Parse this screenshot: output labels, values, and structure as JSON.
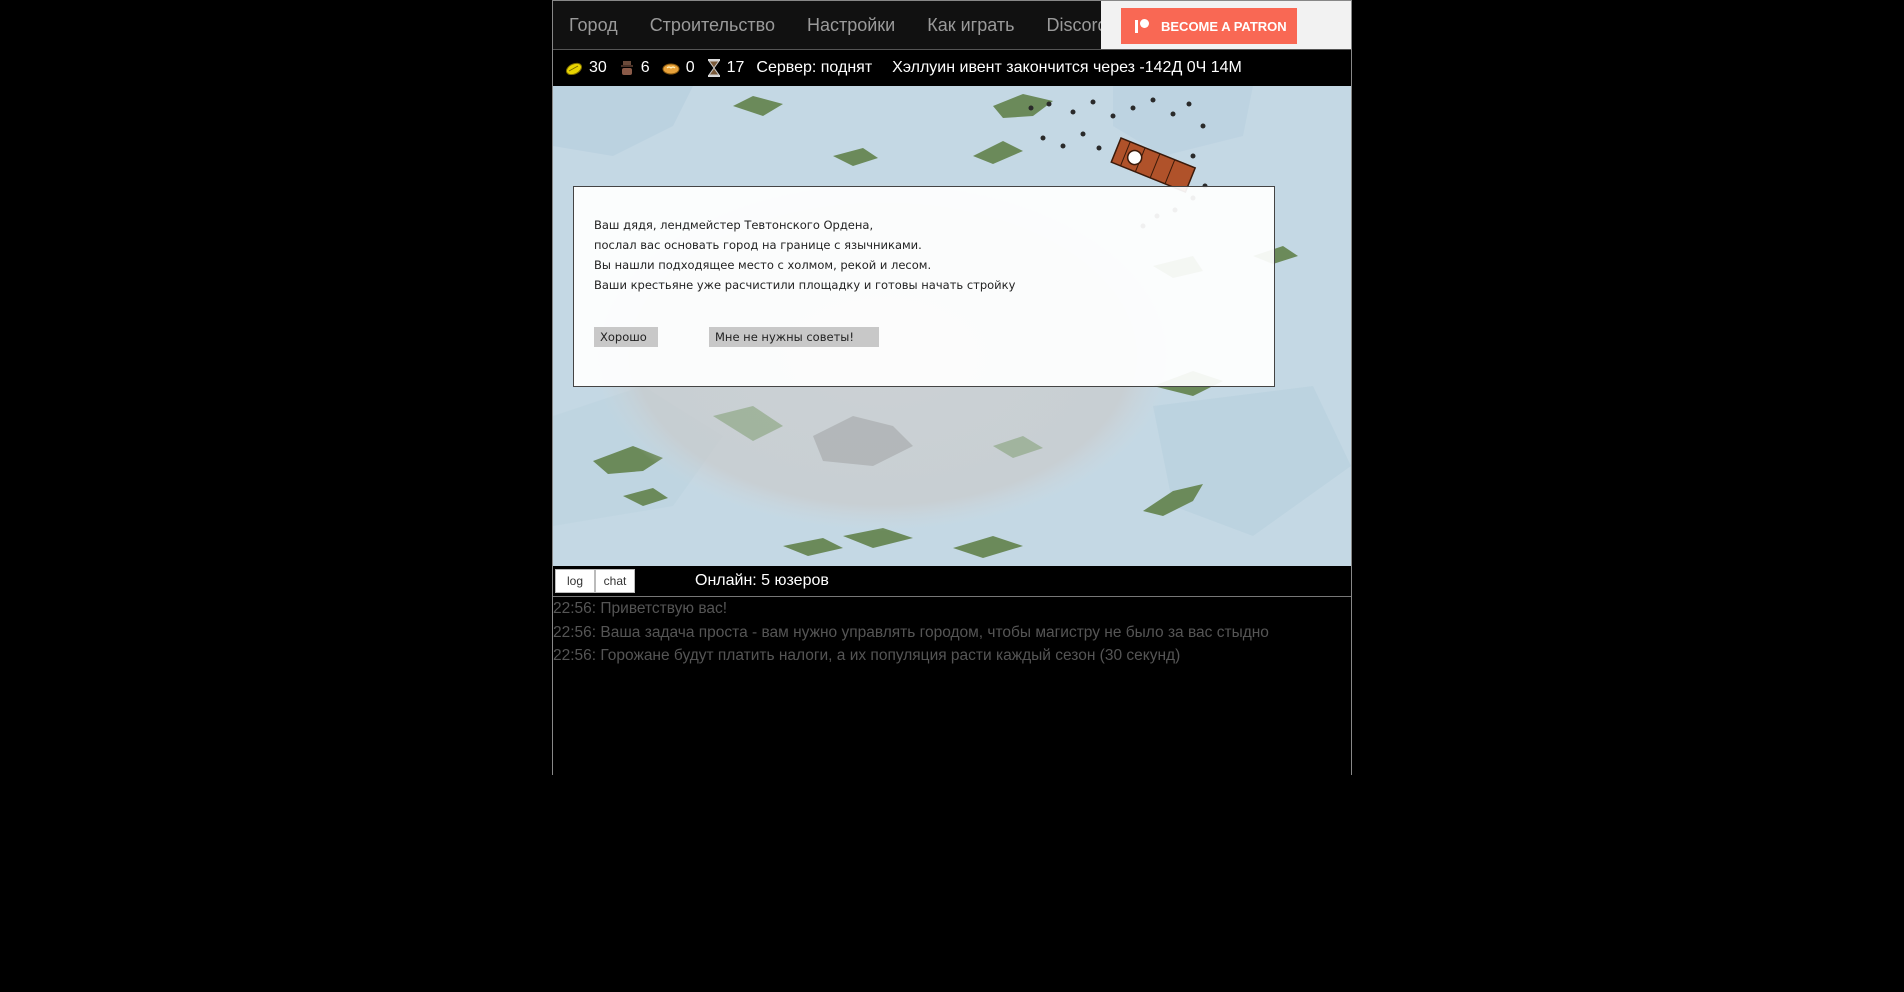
{
  "nav": {
    "tabs": [
      "Город",
      "Строительство",
      "Настройки",
      "Как играть",
      "Discord"
    ],
    "patron_label": "BECOME A PATRON",
    "patron_color": "#f96854"
  },
  "status": {
    "gold": "30",
    "people": "6",
    "food": "0",
    "time": "17",
    "server": "Сервер: поднят",
    "event": "Хэллуин ивент закончится через -142Д 0Ч 14М",
    "icons": [
      "gold-icon",
      "people-icon",
      "food-icon",
      "hourglass-icon"
    ]
  },
  "dialog": {
    "lines": [
      "Ваш дядя, лендмейстер Тевтонского Ордена,",
      "послал вас основать город на границе с язычниками.",
      "Вы нашли подходящее место с холмом, рекой и лесом.",
      "Ваши крестьяне уже расчистили площадку и готовы начать стройку"
    ],
    "ok_label": "Хорошо",
    "no_tips_label": "Мне не нужны советы!"
  },
  "logbar": {
    "log_label": "log",
    "chat_label": "chat",
    "online": "Онлайн: 5 юзеров"
  },
  "log": {
    "lines": [
      "22:56: Приветствую вас!",
      "22:56: Ваша задача проста - вам нужно управлять городом, чтобы магистру не было за вас стыдно",
      "22:56: Горожане будут платить налоги, а их популяция расти каждый сезон (30 секунд)"
    ]
  }
}
